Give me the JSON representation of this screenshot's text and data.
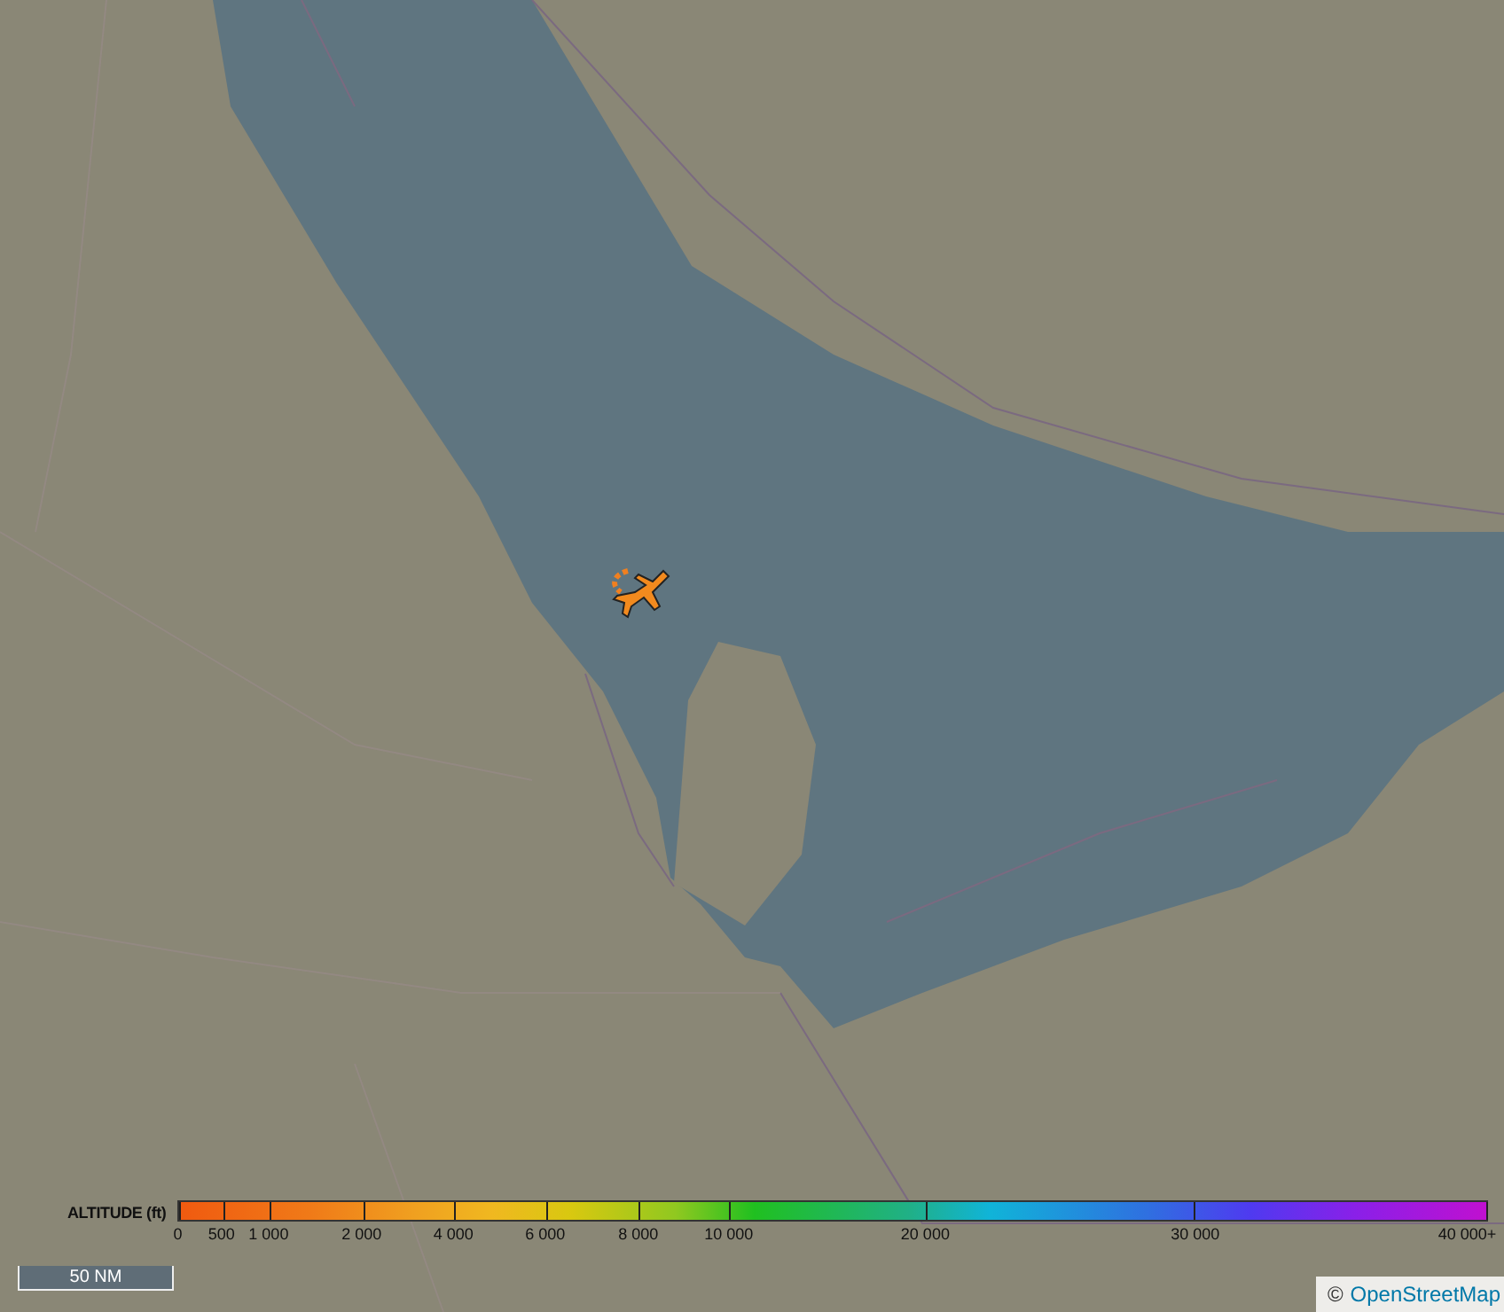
{
  "altitude_legend": {
    "title": "ALTITUDE (ft)",
    "ticks": [
      "0",
      "500",
      "1 000",
      "2 000",
      "4 000",
      "6 000",
      "8 000",
      "10 000",
      "20 000",
      "30 000",
      "40 000+"
    ]
  },
  "scale_bar": {
    "label": "50 NM"
  },
  "attribution": {
    "symbol": "©",
    "link": "OpenStreetMap"
  }
}
